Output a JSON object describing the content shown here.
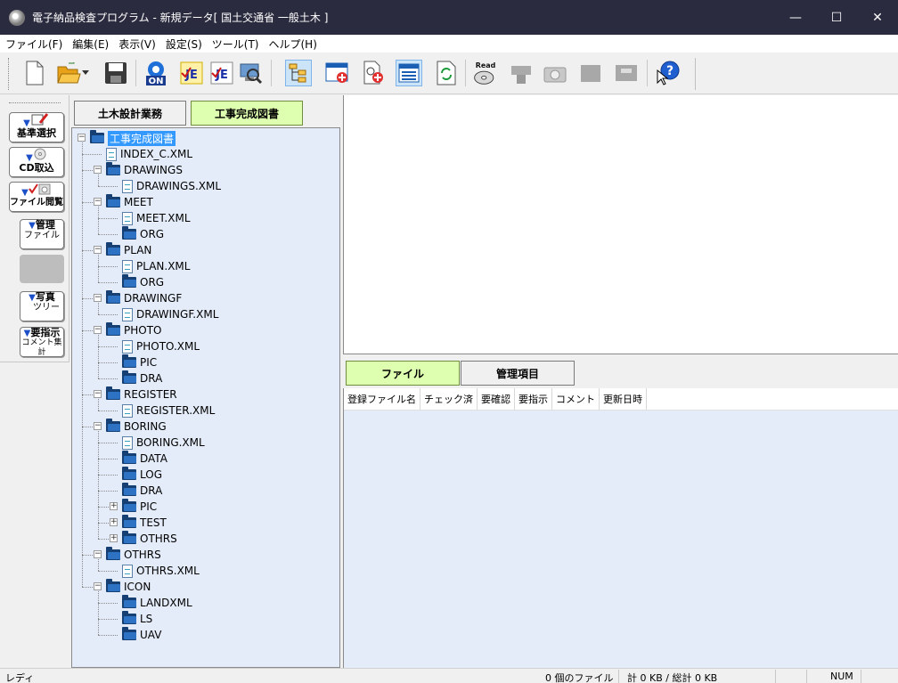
{
  "window": {
    "title": "電子納品検査プログラム - 新規データ[ 国土交通省 一般土木 ]",
    "minimize": "—",
    "maximize": "☐",
    "close": "✕"
  },
  "menu": [
    "ファイル(F)",
    "編集(E)",
    "表示(V)",
    "設定(S)",
    "ツール(T)",
    "ヘルプ(H)"
  ],
  "toolbar": {
    "read_label": "Read",
    "on_label": "ON",
    "je_label": "JE",
    "icons": [
      "new-file-icon",
      "open-folder-icon",
      "dropdown-arrow-icon",
      "save-icon",
      "check-on-icon",
      "je-check-icon",
      "je-check-2-icon",
      "search-pc-icon",
      "tree-view-icon",
      "add-window-icon",
      "add-document-icon",
      "list-view-icon",
      "refresh-icon",
      "read-disc-icon",
      "person-disabled-icon",
      "camera-disabled-icon",
      "box-disabled-icon",
      "tool-disabled-icon",
      "help-icon"
    ]
  },
  "sidebar": {
    "buttons": [
      {
        "label": "基準選択"
      },
      {
        "label": "CD取込"
      },
      {
        "label": "ファイル閲覧"
      },
      {
        "label1": "管理",
        "label2": "ファイル"
      },
      {
        "label1": "写真",
        "label2": "ツリー"
      },
      {
        "label1": "要指示",
        "label2": "コメント集計"
      }
    ]
  },
  "left_tabs": {
    "civil": "土木設計業務",
    "construction": "工事完成図書"
  },
  "tree": [
    {
      "label": "工事完成図書",
      "type": "root",
      "level": 0,
      "expander": "minus"
    },
    {
      "label": "INDEX_C.XML",
      "type": "file",
      "level": 1
    },
    {
      "label": "DRAWINGS",
      "type": "folder",
      "level": 1,
      "expander": "minus"
    },
    {
      "label": "DRAWINGS.XML",
      "type": "file",
      "level": 2
    },
    {
      "label": "MEET",
      "type": "folder",
      "level": 1,
      "expander": "minus"
    },
    {
      "label": "MEET.XML",
      "type": "file",
      "level": 2
    },
    {
      "label": "ORG",
      "type": "folder",
      "level": 2
    },
    {
      "label": "PLAN",
      "type": "folder",
      "level": 1,
      "expander": "minus"
    },
    {
      "label": "PLAN.XML",
      "type": "file",
      "level": 2
    },
    {
      "label": "ORG",
      "type": "folder",
      "level": 2
    },
    {
      "label": "DRAWINGF",
      "type": "folder",
      "level": 1,
      "expander": "minus"
    },
    {
      "label": "DRAWINGF.XML",
      "type": "file",
      "level": 2
    },
    {
      "label": "PHOTO",
      "type": "folder",
      "level": 1,
      "expander": "minus"
    },
    {
      "label": "PHOTO.XML",
      "type": "file",
      "level": 2
    },
    {
      "label": "PIC",
      "type": "folder",
      "level": 2
    },
    {
      "label": "DRA",
      "type": "folder",
      "level": 2
    },
    {
      "label": "REGISTER",
      "type": "folder",
      "level": 1,
      "expander": "minus"
    },
    {
      "label": "REGISTER.XML",
      "type": "file",
      "level": 2
    },
    {
      "label": "BORING",
      "type": "folder",
      "level": 1,
      "expander": "minus"
    },
    {
      "label": "BORING.XML",
      "type": "file",
      "level": 2
    },
    {
      "label": "DATA",
      "type": "folder",
      "level": 2
    },
    {
      "label": "LOG",
      "type": "folder",
      "level": 2
    },
    {
      "label": "DRA",
      "type": "folder",
      "level": 2
    },
    {
      "label": "PIC",
      "type": "folder",
      "level": 2,
      "expander": "plus"
    },
    {
      "label": "TEST",
      "type": "folder",
      "level": 2,
      "expander": "plus"
    },
    {
      "label": "OTHRS",
      "type": "folder",
      "level": 2,
      "expander": "plus"
    },
    {
      "label": "OTHRS",
      "type": "folder",
      "level": 1,
      "expander": "minus"
    },
    {
      "label": "OTHRS.XML",
      "type": "file",
      "level": 2
    },
    {
      "label": "ICON",
      "type": "folder",
      "level": 1,
      "expander": "minus"
    },
    {
      "label": "LANDXML",
      "type": "folder",
      "level": 2
    },
    {
      "label": "LS",
      "type": "folder",
      "level": 2
    },
    {
      "label": "UAV",
      "type": "folder",
      "level": 2
    }
  ],
  "right_tabs": {
    "file": "ファイル",
    "manage": "管理項目"
  },
  "grid": {
    "columns": [
      "登録ファイル名",
      "チェック済",
      "要確認",
      "要指示",
      "コメント",
      "更新日時"
    ]
  },
  "status": {
    "ready": "レディ",
    "file_count": "0 個のファイル",
    "size": "計 0 KB / 総計 0 KB",
    "num": "NUM"
  }
}
